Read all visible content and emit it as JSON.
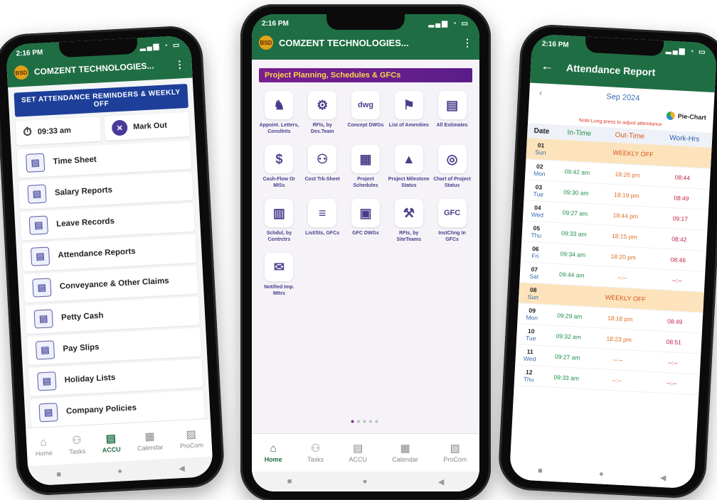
{
  "status_time": "2:16 PM",
  "company": "COMZENT TECHNOLOGIES...",
  "logo_text": "BSD",
  "phone1": {
    "banner": "SET ATTENDANCE REMINDERS & WEEKLY OFF",
    "time": "09:33 am",
    "mark_out": "Mark Out",
    "menu": [
      {
        "label": "Time Sheet",
        "icon": "timesheet-icon"
      },
      {
        "label": "Salary Reports",
        "icon": "salary-icon"
      },
      {
        "label": "Leave Records",
        "icon": "leave-icon"
      },
      {
        "label": "Attendance Reports",
        "icon": "attendance-icon"
      },
      {
        "label": "Conveyance & Other Claims",
        "icon": "claims-icon"
      },
      {
        "label": "Petty Cash",
        "icon": "petty-cash-icon"
      },
      {
        "label": "Pay Slips",
        "icon": "payslip-icon"
      },
      {
        "label": "Holiday Lists",
        "icon": "holiday-icon"
      },
      {
        "label": "Company Policies",
        "icon": "policy-icon"
      }
    ]
  },
  "nav": {
    "home": "Home",
    "tasks": "Tasks",
    "accu": "ACCU",
    "calendar": "Calendar",
    "procom": "ProCom"
  },
  "phone2": {
    "section_title": "Project Planning, Schedules & GFCs",
    "tiles": [
      {
        "label": "Appoint. Letters, Consltnts",
        "glyph": "♞"
      },
      {
        "label": "RFIs, by Des.Team",
        "glyph": "⚙"
      },
      {
        "label": "Concept DWGs",
        "glyph": "dwg"
      },
      {
        "label": "List of Amenities",
        "glyph": "⚑"
      },
      {
        "label": "All Estimates",
        "glyph": "▤"
      },
      {
        "label": "Cash-Flow Or MISs",
        "glyph": "$"
      },
      {
        "label": "Cost Trk-Sheet",
        "glyph": "⚇"
      },
      {
        "label": "Project Schedules",
        "glyph": "▦"
      },
      {
        "label": "Project Milestone Status",
        "glyph": "▲"
      },
      {
        "label": "Chart of Project Status",
        "glyph": "◎"
      },
      {
        "label": "Schdul, by Contrctrs",
        "glyph": "▥"
      },
      {
        "label": "List/Sts, GFCs",
        "glyph": "≡"
      },
      {
        "label": "GFC DWGs",
        "glyph": "▣"
      },
      {
        "label": "RFIs, by SiteTeams",
        "glyph": "⚒"
      },
      {
        "label": "InstChng In GFCs",
        "glyph": "GFC"
      },
      {
        "label": "Notified Imp. Mttrs",
        "glyph": "✉"
      }
    ]
  },
  "phone3": {
    "title": "Attendance Report",
    "month": "Sep 2024",
    "pie_label": "Pie-Chart",
    "note": "Note:Long press to adjust attendance",
    "headers": [
      "Date",
      "In-Time",
      "Out-Time",
      "Work-Hrs"
    ],
    "rows": [
      {
        "day": "01",
        "wd": "Sun",
        "off": "WEEKLY OFF"
      },
      {
        "day": "02",
        "wd": "Mon",
        "in": "09:42 am",
        "out": "18:26 pm",
        "hrs": "08:44"
      },
      {
        "day": "03",
        "wd": "Tue",
        "in": "09:30 am",
        "out": "18:19 pm",
        "hrs": "08:49"
      },
      {
        "day": "04",
        "wd": "Wed",
        "in": "09:27 am",
        "out": "18:44 pm",
        "hrs": "09:17"
      },
      {
        "day": "05",
        "wd": "Thu",
        "in": "09:33 am",
        "out": "18:15 pm",
        "hrs": "08:42"
      },
      {
        "day": "06",
        "wd": "Fri",
        "in": "09:34 am",
        "out": "18:20 pm",
        "hrs": "08:46"
      },
      {
        "day": "07",
        "wd": "Sat",
        "in": "09:44 am",
        "out": "--:--",
        "hrs": "--:--"
      },
      {
        "day": "08",
        "wd": "Sun",
        "off": "WEEKLY OFF"
      },
      {
        "day": "09",
        "wd": "Mon",
        "in": "09:29 am",
        "out": "18:18 pm",
        "hrs": "08:49"
      },
      {
        "day": "10",
        "wd": "Tue",
        "in": "09:32 am",
        "out": "18:23 pm",
        "hrs": "08:51"
      },
      {
        "day": "11",
        "wd": "Wed",
        "in": "09:27 am",
        "out": "--:--",
        "hrs": "--:--"
      },
      {
        "day": "12",
        "wd": "Thu",
        "in": "09:33 am",
        "out": "--:--",
        "hrs": "--:--"
      }
    ]
  }
}
